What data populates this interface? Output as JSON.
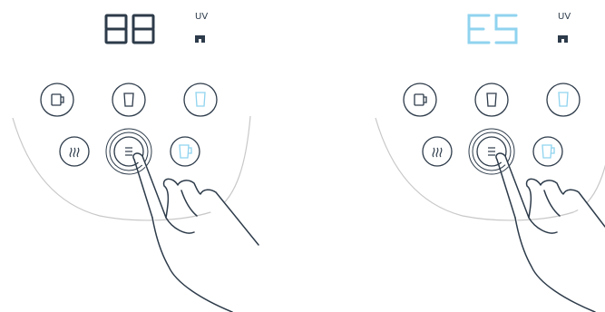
{
  "panels": [
    {
      "id": "before",
      "display_text": "88",
      "display_color": "#2d3b4a",
      "uv_label": "UV",
      "buttons": [
        {
          "name": "mug-button",
          "icon": "mug-icon",
          "highlighted": false
        },
        {
          "name": "cup-button",
          "icon": "cup-icon",
          "highlighted": false
        },
        {
          "name": "tall-cup-button",
          "icon": "tall-cup-icon",
          "highlighted": true
        },
        {
          "name": "steam-button",
          "icon": "steam-icon",
          "highlighted": false
        },
        {
          "name": "menu-button",
          "icon": "menu-icon",
          "highlighted": false,
          "pressed": true
        },
        {
          "name": "pitcher-button",
          "icon": "pitcher-icon",
          "highlighted": true
        }
      ]
    },
    {
      "id": "after",
      "display_text": "ES",
      "display_color": "#8fd3ef",
      "uv_label": "UV",
      "buttons": [
        {
          "name": "mug-button",
          "icon": "mug-icon",
          "highlighted": false
        },
        {
          "name": "cup-button",
          "icon": "cup-icon",
          "highlighted": false
        },
        {
          "name": "tall-cup-button",
          "icon": "tall-cup-icon",
          "highlighted": true
        },
        {
          "name": "steam-button",
          "icon": "steam-icon",
          "highlighted": false
        },
        {
          "name": "menu-button",
          "icon": "menu-icon",
          "highlighted": false,
          "pressed": true
        },
        {
          "name": "pitcher-button",
          "icon": "pitcher-icon",
          "highlighted": true
        }
      ]
    }
  ],
  "colors": {
    "line": "#2d3b4a",
    "accent": "#8fd3ef",
    "body_outline": "#c8c8c8"
  }
}
